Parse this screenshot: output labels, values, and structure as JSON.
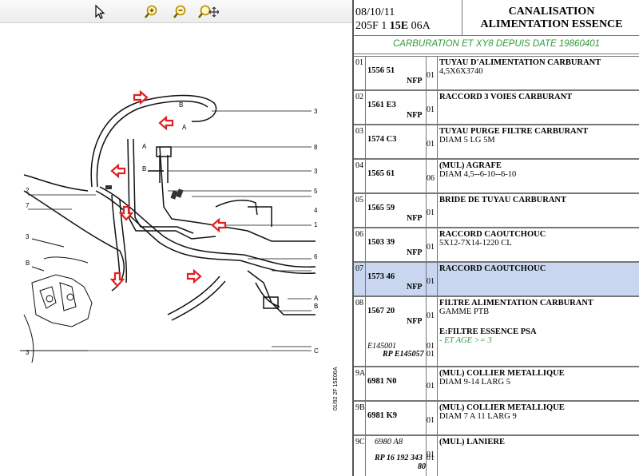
{
  "toolbar": {
    "tools": [
      {
        "name": "pointer-icon"
      },
      {
        "name": "zoom-in-icon"
      },
      {
        "name": "zoom-out-icon"
      },
      {
        "name": "zoom-pan-icon"
      }
    ]
  },
  "diagram": {
    "callouts": [
      "3",
      "8",
      "3",
      "5",
      "4",
      "1",
      "6",
      "A",
      "B",
      "C",
      "2",
      "7",
      "3",
      "B",
      "3",
      "B",
      "A",
      "A",
      "B"
    ],
    "stamp": "01/92   2F   15E06A",
    "colors": {
      "arrow": "#e02020",
      "line": "#111111"
    }
  },
  "header": {
    "date": "08/10/11",
    "ref_prefix": "205F 1 ",
    "ref_bold": "15E",
    "ref_suffix": " 06A",
    "title_line1": "CANALISATION",
    "title_line2": "ALIMENTATION ESSENCE"
  },
  "subtitle": "CARBURATION ET XY8 DEPUIS DATE 19860401",
  "colors": {
    "accent_green": "#2f9c3a",
    "selection": "#c8d7ef"
  },
  "rows": [
    {
      "idx": "01",
      "ref": "1556 51",
      "nfp": "NFP",
      "qty": "01",
      "desc1": "TUYAU D'ALIMENTATION CARBURANT",
      "desc2": "4,5X6X3740"
    },
    {
      "idx": "02",
      "ref": "1561 E3",
      "nfp": "NFP",
      "qty": "01",
      "desc1": "RACCORD 3 VOIES CARBURANT",
      "desc2": ""
    },
    {
      "idx": "03",
      "ref": "1574 C3",
      "nfp": "",
      "qty": "01",
      "desc1": "TUYAU PURGE FILTRE CARBURANT",
      "desc2": "DIAM 5 LG 5M"
    },
    {
      "idx": "04",
      "ref": "1565 61",
      "nfp": "",
      "qty": "06",
      "desc1": "(MUL) AGRAFE",
      "desc2": "DIAM 4,5--6-10--6-10"
    },
    {
      "idx": "05",
      "ref": "1565 59",
      "nfp": "NFP",
      "qty": "01",
      "desc1": "BRIDE DE TUYAU CARBURANT",
      "desc2": ""
    },
    {
      "idx": "06",
      "ref": "1503 39",
      "nfp": "NFP",
      "qty": "01",
      "desc1": "RACCORD CAOUTCHOUC",
      "desc2": "5X12-7X14-1220 CL"
    },
    {
      "idx": "07",
      "ref": "1573 46",
      "nfp": "NFP",
      "qty": "01",
      "desc1": "RACCORD CAOUTCHOUC",
      "desc2": ""
    },
    {
      "idx": "08",
      "ref": "1567 20",
      "nfp": "NFP",
      "qty": "01",
      "desc1": "FILTRE ALIMENTATION CARBURANT",
      "desc2": "GAMME PTB",
      "alt_ref1": "E145001",
      "alt_ref2": "RP E145057",
      "alt_qty1": "01",
      "alt_qty2": "01",
      "extra1": "E:FILTRE ESSENCE PSA",
      "extra2": "- ET AGE >= 3"
    },
    {
      "idx": "9A",
      "ref": "6981 N0",
      "nfp": "",
      "qty": "01",
      "desc1": "(MUL) COLLIER METALLIQUE",
      "desc2": "DIAM 9-14 LARG 5"
    },
    {
      "idx": "9B",
      "ref": "6981 K9",
      "nfp": "",
      "qty": "01",
      "desc1": "(MUL) COLLIER METALLIQUE",
      "desc2": "DIAM 7 A 11 LARG 9"
    },
    {
      "idx": "9C",
      "ref": "6980 A8",
      "nfp": "",
      "qty": "01",
      "desc1": "(MUL) LANIERE",
      "desc2": "",
      "alt_ref1": "RP 16 192 343",
      "alt_ref2": "80",
      "alt_qty1": "01"
    }
  ]
}
